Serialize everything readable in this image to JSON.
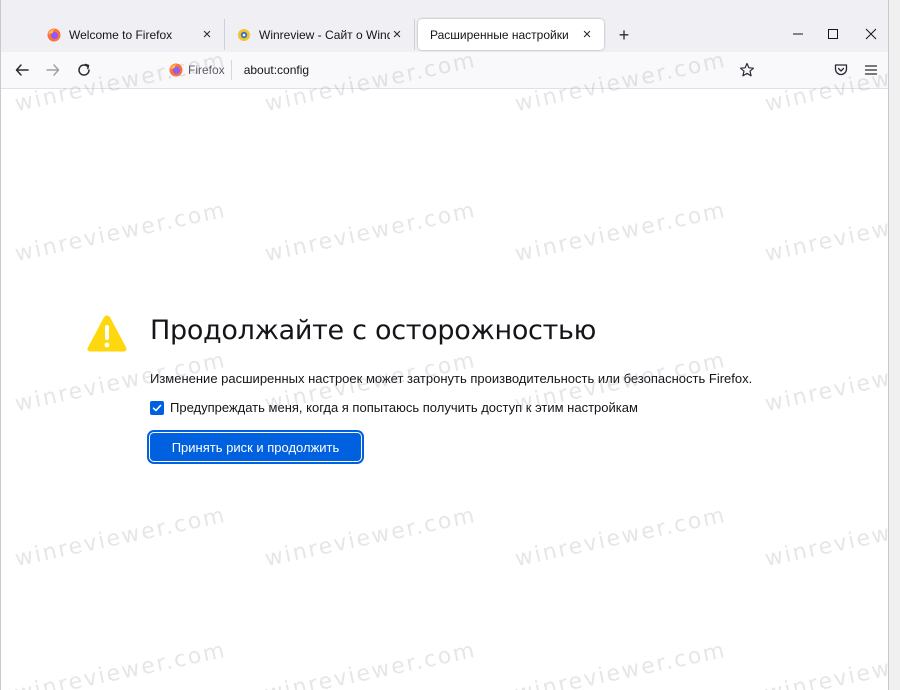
{
  "tabs": [
    {
      "title": "Welcome to Firefox",
      "favicon": "firefox-icon"
    },
    {
      "title": "Winreview - Сайт о Windows",
      "favicon": "winreview-icon"
    },
    {
      "title": "Расширенные настройки",
      "active": true
    }
  ],
  "urlbar": {
    "identity_label": "Firefox",
    "url": "about:config"
  },
  "page": {
    "heading": "Продолжайте с осторожностью",
    "description": "Изменение расширенных настроек может затронуть производительность или безопасность Firefox.",
    "checkbox_label": "Предупреждать меня, когда я попытаюсь получить доступ к этим настройкам",
    "checkbox_checked": true,
    "accept_button": "Принять риск и продолжить"
  },
  "watermark": "winreviewer.com",
  "colors": {
    "accent": "#0061e0",
    "warning": "#ffd70f"
  }
}
